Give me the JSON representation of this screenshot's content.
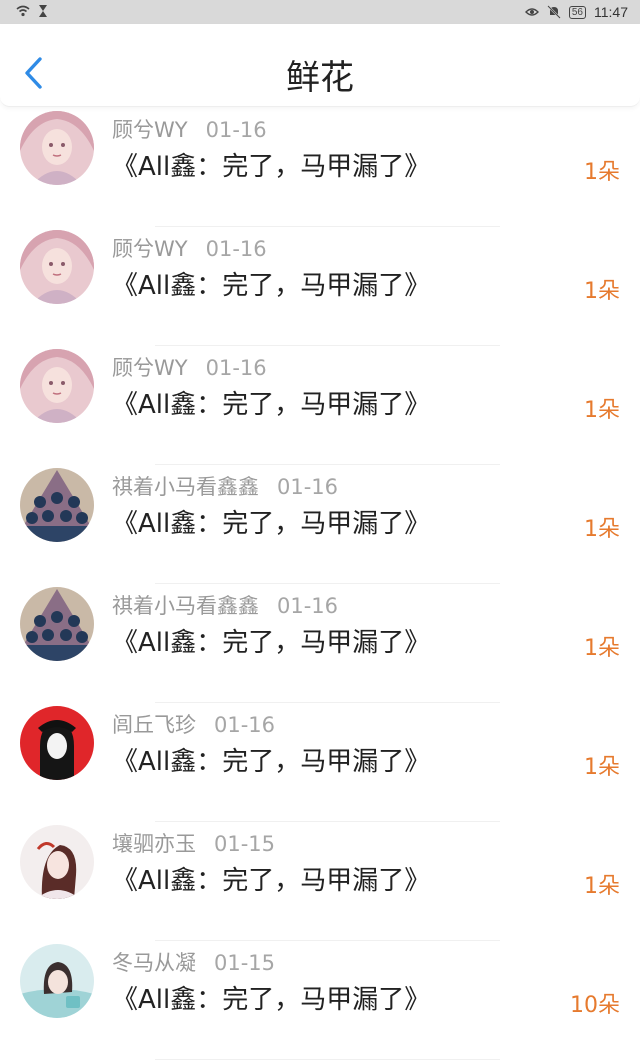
{
  "status": {
    "battery": "56",
    "time": "11:47"
  },
  "header": {
    "title": "鲜花"
  },
  "items": [
    {
      "user": "顾兮WY",
      "date": "01-16",
      "work": "《All鑫：完了，马甲漏了》",
      "count": "1朵",
      "avatar": "pink-girl-avatar"
    },
    {
      "user": "顾兮WY",
      "date": "01-16",
      "work": "《All鑫：完了，马甲漏了》",
      "count": "1朵",
      "avatar": "pink-girl-avatar"
    },
    {
      "user": "顾兮WY",
      "date": "01-16",
      "work": "《All鑫：完了，马甲漏了》",
      "count": "1朵",
      "avatar": "pink-girl-avatar"
    },
    {
      "user": "祺着小马看鑫鑫",
      "date": "01-16",
      "work": "《All鑫：完了，马甲漏了》",
      "count": "1朵",
      "avatar": "group-avatar"
    },
    {
      "user": "祺着小马看鑫鑫",
      "date": "01-16",
      "work": "《All鑫：完了，马甲漏了》",
      "count": "1朵",
      "avatar": "group-avatar"
    },
    {
      "user": "闾丘飞珍",
      "date": "01-16",
      "work": "《All鑫：完了，马甲漏了》",
      "count": "1朵",
      "avatar": "red-anime-avatar"
    },
    {
      "user": "壤驷亦玉",
      "date": "01-15",
      "work": "《All鑫：完了，马甲漏了》",
      "count": "1朵",
      "avatar": "woman-portrait-avatar"
    },
    {
      "user": "冬马从凝",
      "date": "01-15",
      "work": "《All鑫：完了，马甲漏了》",
      "count": "10朵",
      "avatar": "teal-portrait-avatar"
    }
  ],
  "colors": {
    "accent": "#2f8be6",
    "count": "#e67a2e",
    "meta": "#999999"
  }
}
